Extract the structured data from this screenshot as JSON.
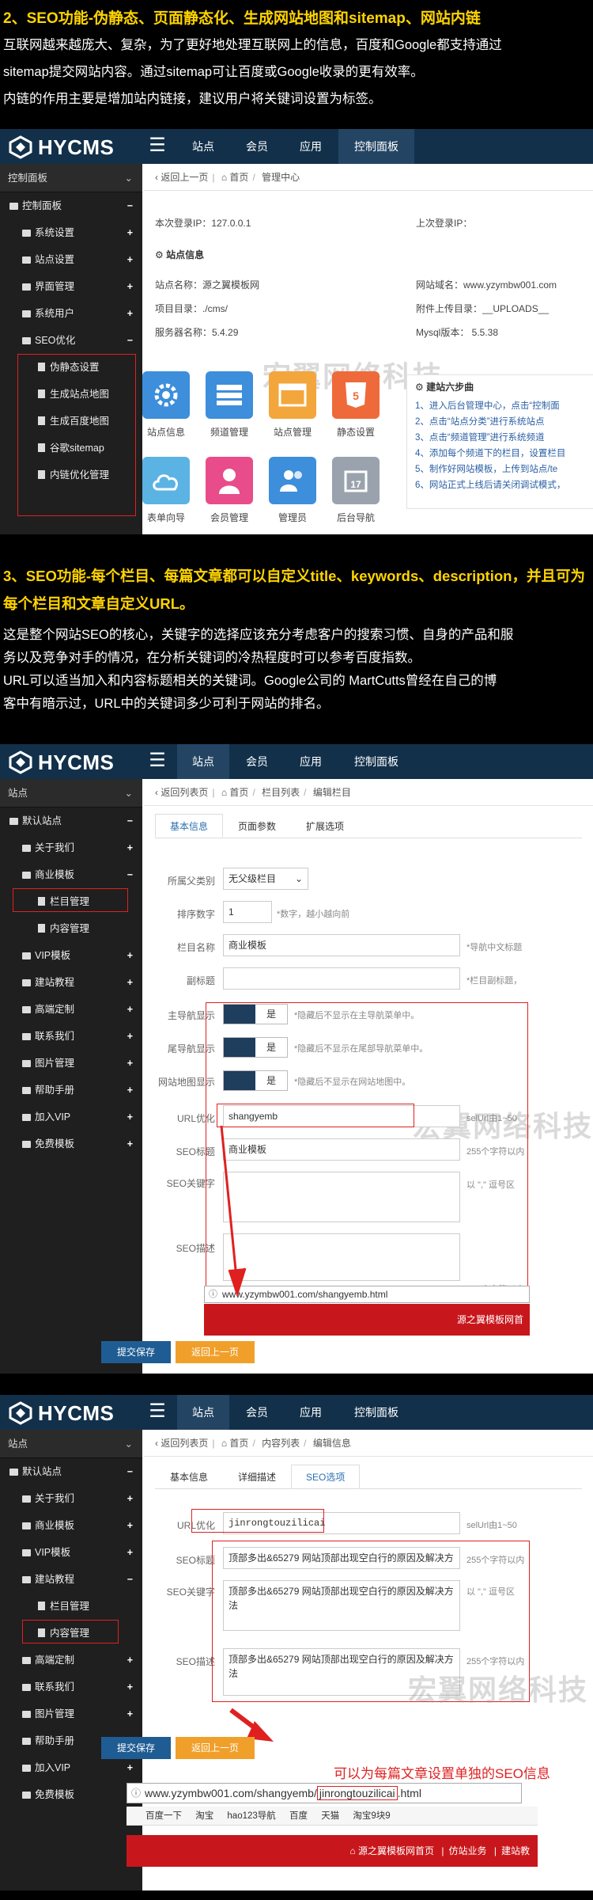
{
  "section2": {
    "title": "2、SEO功能-伪静态、页面静态化、生成网站地图和sitemap、网站内链",
    "p1": "互联网越来越庞大、复杂，为了更好地处理互联网上的信息，百度和Google都支持通过",
    "p2": "sitemap提交网站内容。通过sitemap可让百度或Google收录的更有效率。",
    "p3": "内链的作用主要是增加站内链接，建议用户将关键词设置为标签。"
  },
  "section3": {
    "title1": "3、SEO功能-每个栏目、每篇文章都可以自定义title、keywords、description，并且可为",
    "title2": "每个栏目和文章自定义URL。",
    "p1": "这是整个网站SEO的核心，关键字的选择应该充分考虑客户的搜索习惯、自身的产品和服",
    "p2": "务以及竞争对手的情况，在分析关键词的冷热程度时可以参考百度指数。",
    "p3": "URL可以适当加入和内容标题相关的关键词。Google公司的   MartCutts曾经在自己的博",
    "p4": "客中有暗示过，URL中的关键词多少可利于网站的排名。"
  },
  "brand": "HYCMS",
  "nav": {
    "site": "站点",
    "member": "会员",
    "app": "应用",
    "control": "控制面板"
  },
  "watermark": "宏翼网络科技",
  "shot1": {
    "side_head": "控制面板",
    "items": [
      "控制面板",
      "系统设置",
      "站点设置",
      "界面管理",
      "系统用户",
      "SEO优化"
    ],
    "seo_sub": [
      "伪静态设置",
      "生成站点地图",
      "生成百度地图",
      "谷歌sitemap",
      "内链优化管理"
    ],
    "crumb": [
      "返回上一页",
      "首页",
      "管理中心"
    ],
    "last_login_ip": "本次登录IP：127.0.0.1",
    "prev_login_ip": "上次登录IP：",
    "info_title": "站点信息",
    "site_name": "站点名称：源之翼模板网",
    "domain": "网站域名：www.yzymbw001.com",
    "project_dir": "项目目录：./cms/",
    "upload_dir": "附件上传目录：__UPLOADS__",
    "server": "服务器名称：5.4.29",
    "mysql": "Mysql版本： 5.5.38",
    "tiles": [
      "站点信息",
      "频道管理",
      "站点管理",
      "静态设置",
      "表单向导",
      "会员管理",
      "管理员",
      "后台导航"
    ],
    "steps_title": "建站六步曲",
    "steps": [
      "1、进入后台管理中心，点击“控制面",
      "2、点击“站点分类”进行系统站点",
      "3、点击“频道管理”进行系统频道",
      "4、添加每个频道下的栏目，设置栏目",
      "5、制作好网站模板，上传到站点/te",
      "6、网站正式上线后请关闭调试模式，"
    ]
  },
  "shot2": {
    "side_head": "站点",
    "items": [
      "默认站点",
      "关于我们",
      "商业模板",
      "栏目管理",
      "内容管理",
      "VIP模板",
      "建站教程",
      "高端定制",
      "联系我们",
      "图片管理",
      "帮助手册",
      "加入VIP",
      "免费模板"
    ],
    "crumb": [
      "返回列表页",
      "首页",
      "栏目列表",
      "编辑栏目"
    ],
    "tabs": [
      "基本信息",
      "页面参数",
      "扩展选项"
    ],
    "parent_label": "所属父类别",
    "parent_value": "无父级栏目",
    "order_label": "排序数字",
    "order_value": "1",
    "order_hint": "*数字，越小越向前",
    "name_label": "栏目名称",
    "name_value": "商业模板",
    "name_hint": "*导航中文标题",
    "subtitle_label": "副标题",
    "subtitle_hint": "*栏目副标题，",
    "main_nav_label": "主导航显示",
    "main_nav_hint": "*隐藏后不显示在主导航菜单中。",
    "tail_nav_label": "尾导航显示",
    "tail_nav_hint": "*隐藏后不显示在尾部导航菜单中。",
    "sitemap_label": "网站地图显示",
    "sitemap_hint": "*隐藏后不显示在网站地图中。",
    "yes": "是",
    "url_label": "URL优化",
    "url_value": "shangyemb",
    "url_hint": "selUrl由1~50",
    "seo_title_label": "SEO标题",
    "seo_title_value": "商业模板",
    "seo_title_hint": "255个字符以内",
    "seo_kw_label": "SEO关键字",
    "seo_kw_hint": "以 \",\" 逗号区",
    "seo_desc_label": "SEO描述",
    "seo_desc_hint": "255个字符以内",
    "browser_url": "www.yzymbw001.com/shangyemb.html",
    "footer_brand": "源之翼模板网首",
    "save": "提交保存",
    "back": "返回上一页"
  },
  "shot3": {
    "side_head": "站点",
    "items": [
      "默认站点",
      "关于我们",
      "商业模板",
      "VIP模板",
      "建站教程",
      "栏目管理",
      "内容管理",
      "高端定制",
      "联系我们",
      "图片管理",
      "帮助手册",
      "加入VIP",
      "免费模板"
    ],
    "crumb": [
      "返回列表页",
      "首页",
      "内容列表",
      "编辑信息"
    ],
    "tabs": [
      "基本信息",
      "详细描述",
      "SEO选项"
    ],
    "url_label": "URL优化",
    "url_value": "jinrongtouzilicai",
    "url_hint": "selUrl由1~50",
    "seo_title_label": "SEO标题",
    "seo_value": "顶部多出&65279 网站顶部出现空白行的原因及解决方",
    "seo_value_end": "法",
    "seo_title_hint": "255个字符以内",
    "seo_kw_label": "SEO关键字",
    "seo_kw_hint": "以 \",\" 逗号区",
    "seo_desc_label": "SEO描述",
    "seo_desc_hint": "255个字符以内",
    "annotation": "可以为每篇文章设置单独的SEO信息",
    "browser_url_a": "www.yzymbw001.com/shangyemb/",
    "browser_url_b": "jinrongtouzilicai",
    "browser_url_c": ".html",
    "bookmarks": [
      "百度一下",
      "淘宝",
      "hao123导航",
      "百度",
      "天猫",
      "淘宝9块9"
    ],
    "footer_links": [
      "源之翼模板网首页",
      "仿站业务",
      "建站教"
    ],
    "save": "提交保存",
    "back": "返回上一页"
  },
  "colors": {
    "yellow": "#ffd400",
    "navy": "#12304a",
    "sidebar": "#1f1f1f",
    "red": "#e02020",
    "blue_btn": "#1f5c93",
    "orange_btn": "#f0a02a"
  }
}
